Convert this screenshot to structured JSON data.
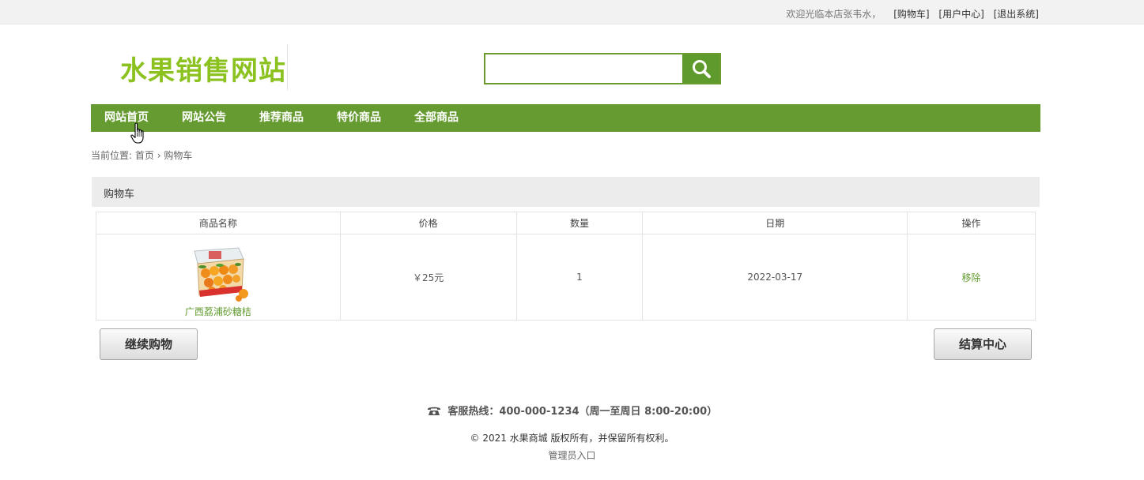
{
  "topbar": {
    "welcome": "欢迎光临本店张韦水，",
    "cart_link": "[购物车]",
    "user_center_link": "[用户中心]",
    "logout_link": "[退出系统]"
  },
  "header": {
    "logo_text": "水果销售网站",
    "search": {
      "value": "",
      "placeholder": ""
    }
  },
  "nav": {
    "items": [
      {
        "label": "网站首页"
      },
      {
        "label": "网站公告"
      },
      {
        "label": "推荐商品"
      },
      {
        "label": "特价商品"
      },
      {
        "label": "全部商品"
      }
    ]
  },
  "breadcrumb": {
    "prefix": "当前位置:",
    "home": "首页",
    "separator": "›",
    "current": "购物车"
  },
  "cart": {
    "title": "购物车",
    "columns": [
      "商品名称",
      "价格",
      "数量",
      "日期",
      "操作"
    ],
    "rows": [
      {
        "name": "广西荔浦砂糖桔",
        "price": "￥25元",
        "quantity": "1",
        "date": "2022-03-17",
        "action": "移除"
      }
    ],
    "continue_button": "继续购物",
    "checkout_button": "结算中心"
  },
  "footer": {
    "hotline": "客服热线：400-000-1234（周一至周日 8:00-20:00）",
    "copyright": "© 2021 水果商城 版权所有，并保留所有权利。",
    "admin_link": "管理员入口"
  },
  "colors": {
    "brand_green": "#669b31",
    "logo_green": "#8cc21f",
    "link_green": "#5f9a2d"
  },
  "icons": {
    "search": "search-icon",
    "phone": "phone-icon",
    "cursor": "hand-cursor-icon"
  }
}
